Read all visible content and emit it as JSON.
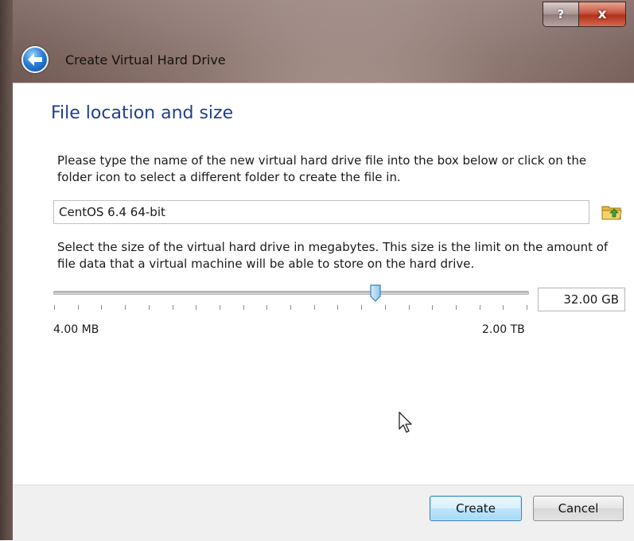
{
  "window": {
    "title": "Create Virtual Hard Drive",
    "help_label": "?",
    "close_label": "x"
  },
  "page": {
    "heading": "File location and size",
    "location_description": "Please type the name of the new virtual hard drive file into the box below or click on the folder icon to select a different folder to create the file in.",
    "file_name_value": "CentOS 6.4 64-bit",
    "size_description": "Select the size of the virtual hard drive in megabytes. This size is the limit on the amount of file data that a virtual machine will be able to store on the hard drive.",
    "slider": {
      "min_label": "4.00 MB",
      "max_label": "2.00 TB",
      "position_fraction": 0.68,
      "tick_count": 21
    },
    "size_value": "32.00 GB"
  },
  "buttons": {
    "create_label": "Create",
    "cancel_label": "Cancel"
  },
  "icons": {
    "back": "back-arrow-icon",
    "folder": "folder-icon"
  },
  "colors": {
    "heading": "#1f3f8f",
    "accent_button_border": "#3c7fb1"
  }
}
